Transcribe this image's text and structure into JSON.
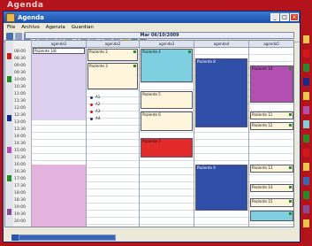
{
  "banner": {
    "title": "Agenda"
  },
  "window": {
    "title": "Agenda"
  },
  "menu": [
    "File",
    "Archivo",
    "Agenzia",
    "Guardian"
  ],
  "date_header": "Mar 06/10/2009",
  "columns": [
    {
      "label": "agenda1"
    },
    {
      "label": "agenda2"
    },
    {
      "label": "agenda3"
    },
    {
      "label": "agenda4"
    },
    {
      "label": "agenda5"
    }
  ],
  "times": [
    "08:00",
    "08:30",
    "09:00",
    "09:30",
    "10:00",
    "10:30",
    "11:00",
    "11:30",
    "12:00",
    "12:30",
    "13:00",
    "13:30",
    "14:00",
    "14:30",
    "15:00",
    "15:30",
    "16:00",
    "16:30",
    "17:00",
    "17:30",
    "18:00",
    "18:30",
    "19:00",
    "19:30",
    "20:00"
  ],
  "appointments": [
    {
      "col": 0,
      "label": "Paziente 1/8",
      "color": "#ffffff"
    },
    {
      "col": 1,
      "label": "Paziente 2",
      "color": "#fdf6dc"
    },
    {
      "col": 1,
      "label": "Paziente 3",
      "color": "#fdf6dc"
    },
    {
      "col": 2,
      "label": "Paziente 4",
      "color": "#7ecfe0"
    },
    {
      "col": 2,
      "label": "Paziente 5",
      "color": "#fdf6dc"
    },
    {
      "col": 2,
      "label": "Paziente 6",
      "color": "#fdf6dc"
    },
    {
      "col": 2,
      "label": "Paziente 7",
      "color": "#e32a2a"
    },
    {
      "col": 3,
      "label": "Paziente 8",
      "color": "#2f4fa8"
    },
    {
      "col": 3,
      "label": "Paziente 9",
      "color": "#2f4fa8"
    },
    {
      "col": 4,
      "label": "Paziente 10",
      "color": "#b34fb0"
    },
    {
      "col": 4,
      "label": "Paziente 11",
      "color": "#fdf6dc"
    },
    {
      "col": 4,
      "label": "Paziente 12",
      "color": "#fdf6dc"
    },
    {
      "col": 4,
      "label": "Paziente 13",
      "color": "#fdf6dc"
    },
    {
      "col": 4,
      "label": "Paziente 14",
      "color": "#fdf6dc"
    },
    {
      "col": 4,
      "label": "Paziente 15",
      "color": "#7ecfe0"
    }
  ],
  "legend": [
    {
      "label": "A1",
      "color": "#1a2a8a"
    },
    {
      "label": "A2",
      "color": "#d01818"
    },
    {
      "label": "A3",
      "color": "#d01818"
    },
    {
      "label": "A4",
      "color": "#1a2a8a"
    }
  ],
  "colors": {
    "banner": "#b3141c",
    "pink_block": "#e3b3de",
    "lavender_block": "#ddd0ef",
    "blue_block": "#2f4fa8",
    "red_block": "#e32a2a",
    "cyan_block": "#7ecfe0",
    "magenta_block": "#b34fb0",
    "cream_block": "#fdf6dc"
  }
}
